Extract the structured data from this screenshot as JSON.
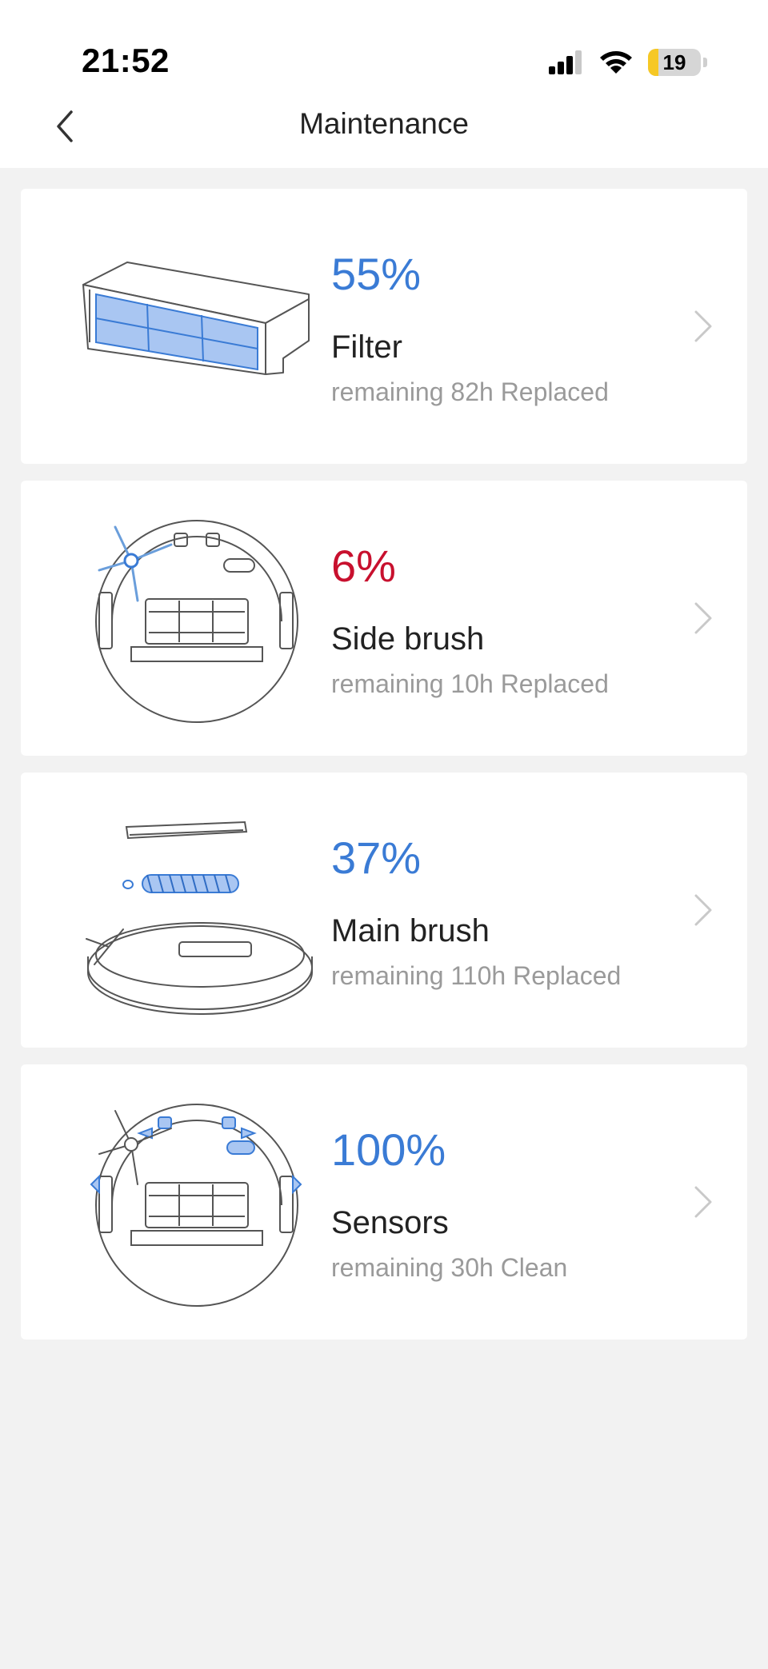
{
  "status_bar": {
    "time": "21:52",
    "battery": "19",
    "battery_level": 0.19
  },
  "header": {
    "title": "Maintenance"
  },
  "colors": {
    "ok": "#3a7bd5",
    "low": "#c8102e",
    "accent_fill": "#a9c6f2"
  },
  "items": [
    {
      "percent": "55%",
      "name": "Filter",
      "detail": "remaining 82h Replaced",
      "status": "ok",
      "icon": "filter-icon"
    },
    {
      "percent": "6%",
      "name": "Side brush",
      "detail": "remaining 10h Replaced",
      "status": "low",
      "icon": "side-brush-icon"
    },
    {
      "percent": "37%",
      "name": "Main brush",
      "detail": "remaining 110h Replaced",
      "status": "ok",
      "icon": "main-brush-icon"
    },
    {
      "percent": "100%",
      "name": "Sensors",
      "detail": "remaining 30h Clean",
      "status": "ok",
      "icon": "sensors-icon"
    }
  ]
}
